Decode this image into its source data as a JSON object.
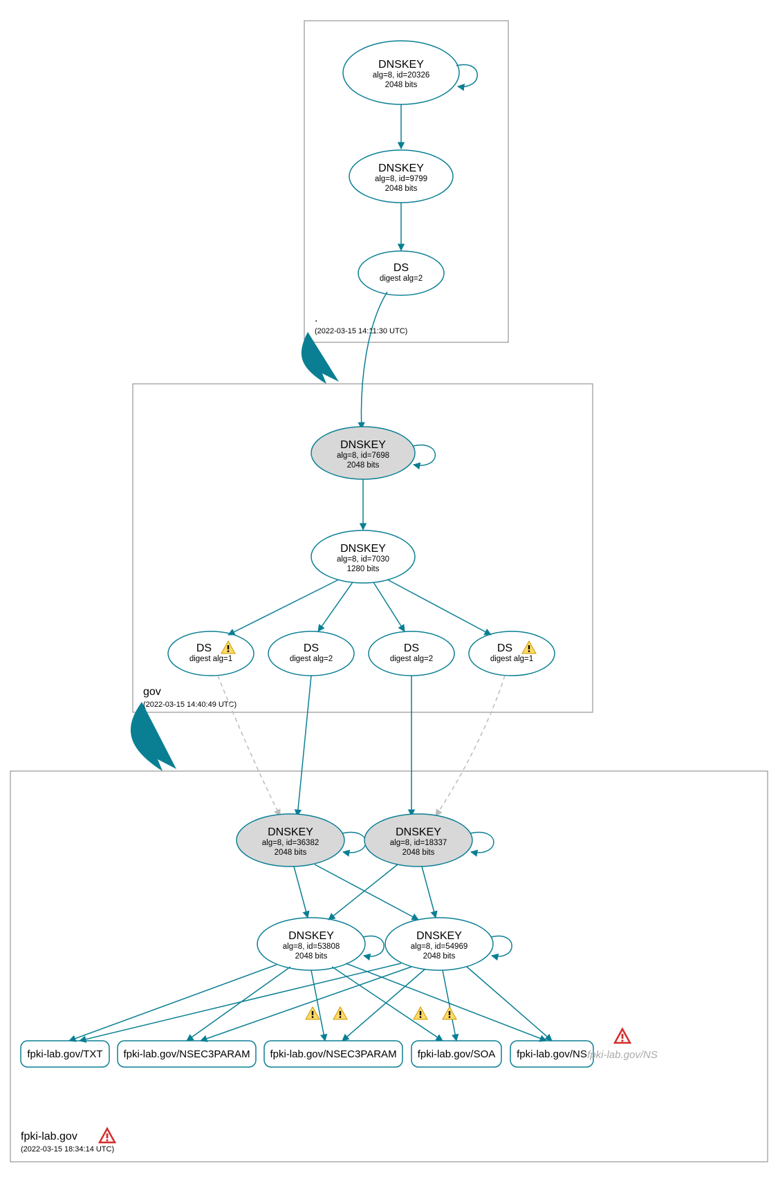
{
  "colors": {
    "accent": "#0a7f94",
    "node_fill": "#d8d8d8",
    "box_stroke": "#808080",
    "warn_yellow": "#ffd966",
    "warn_red": "#d62b2b"
  },
  "zones": {
    "root": {
      "label": ".",
      "timestamp": "(2022-03-15 14:11:30 UTC)"
    },
    "gov": {
      "label": "gov",
      "timestamp": "(2022-03-15 14:40:49 UTC)"
    },
    "leaf": {
      "label": "fpki-lab.gov",
      "timestamp": "(2022-03-15 18:34:14 UTC)",
      "has_error": true
    }
  },
  "nodes": {
    "root_ksk": {
      "title": "DNSKEY",
      "sub1": "alg=8, id=20326",
      "sub2": "2048 bits"
    },
    "root_zsk": {
      "title": "DNSKEY",
      "sub1": "alg=8, id=9799",
      "sub2": "2048 bits"
    },
    "root_ds": {
      "title": "DS",
      "sub1": "digest alg=2",
      "sub2": ""
    },
    "gov_ksk": {
      "title": "DNSKEY",
      "sub1": "alg=8, id=7698",
      "sub2": "2048 bits"
    },
    "gov_zsk": {
      "title": "DNSKEY",
      "sub1": "alg=8, id=7030",
      "sub2": "1280 bits"
    },
    "gov_ds1": {
      "title": "DS",
      "sub1": "digest alg=1",
      "warn": true
    },
    "gov_ds2": {
      "title": "DS",
      "sub1": "digest alg=2"
    },
    "gov_ds3": {
      "title": "DS",
      "sub1": "digest alg=2"
    },
    "gov_ds4": {
      "title": "DS",
      "sub1": "digest alg=1",
      "warn": true
    },
    "leaf_ksk1": {
      "title": "DNSKEY",
      "sub1": "alg=8, id=36382",
      "sub2": "2048 bits"
    },
    "leaf_ksk2": {
      "title": "DNSKEY",
      "sub1": "alg=8, id=18337",
      "sub2": "2048 bits"
    },
    "leaf_zsk1": {
      "title": "DNSKEY",
      "sub1": "alg=8, id=53808",
      "sub2": "2048 bits"
    },
    "leaf_zsk2": {
      "title": "DNSKEY",
      "sub1": "alg=8, id=54969",
      "sub2": "2048 bits"
    }
  },
  "rrsets": {
    "txt": {
      "label": "fpki-lab.gov/TXT"
    },
    "nsec1": {
      "label": "fpki-lab.gov/NSEC3PARAM"
    },
    "nsec2": {
      "label": "fpki-lab.gov/NSEC3PARAM"
    },
    "soa": {
      "label": "fpki-lab.gov/SOA"
    },
    "ns": {
      "label": "fpki-lab.gov/NS"
    },
    "ns_err": {
      "label": "fpki-lab.gov/NS"
    }
  },
  "chart_data": {
    "type": "graph",
    "description": "DNSSEC authentication chain (DNSViz-style)",
    "zones": [
      {
        "name": ".",
        "timestamp": "2022-03-15 14:11:30 UTC"
      },
      {
        "name": "gov",
        "timestamp": "2022-03-15 14:40:49 UTC"
      },
      {
        "name": "fpki-lab.gov",
        "timestamp": "2022-03-15 18:34:14 UTC",
        "status": "error"
      }
    ],
    "nodes": [
      {
        "id": "root_ksk",
        "zone": ".",
        "type": "DNSKEY",
        "alg": 8,
        "key_id": 20326,
        "bits": 2048,
        "role": "KSK",
        "trust_anchor": true,
        "self_sig": true
      },
      {
        "id": "root_zsk",
        "zone": ".",
        "type": "DNSKEY",
        "alg": 8,
        "key_id": 9799,
        "bits": 2048,
        "role": "ZSK"
      },
      {
        "id": "root_ds",
        "zone": ".",
        "type": "DS",
        "digest_alg": 2
      },
      {
        "id": "gov_ksk",
        "zone": "gov",
        "type": "DNSKEY",
        "alg": 8,
        "key_id": 7698,
        "bits": 2048,
        "role": "KSK",
        "self_sig": true
      },
      {
        "id": "gov_zsk",
        "zone": "gov",
        "type": "DNSKEY",
        "alg": 8,
        "key_id": 7030,
        "bits": 1280,
        "role": "ZSK"
      },
      {
        "id": "gov_ds1",
        "zone": "gov",
        "type": "DS",
        "digest_alg": 1,
        "status": "warning"
      },
      {
        "id": "gov_ds2",
        "zone": "gov",
        "type": "DS",
        "digest_alg": 2
      },
      {
        "id": "gov_ds3",
        "zone": "gov",
        "type": "DS",
        "digest_alg": 2
      },
      {
        "id": "gov_ds4",
        "zone": "gov",
        "type": "DS",
        "digest_alg": 1,
        "status": "warning"
      },
      {
        "id": "leaf_ksk1",
        "zone": "fpki-lab.gov",
        "type": "DNSKEY",
        "alg": 8,
        "key_id": 36382,
        "bits": 2048,
        "role": "KSK",
        "self_sig": true
      },
      {
        "id": "leaf_ksk2",
        "zone": "fpki-lab.gov",
        "type": "DNSKEY",
        "alg": 8,
        "key_id": 18337,
        "bits": 2048,
        "role": "KSK",
        "self_sig": true
      },
      {
        "id": "leaf_zsk1",
        "zone": "fpki-lab.gov",
        "type": "DNSKEY",
        "alg": 8,
        "key_id": 53808,
        "bits": 2048,
        "role": "ZSK",
        "self_sig": true
      },
      {
        "id": "leaf_zsk2",
        "zone": "fpki-lab.gov",
        "type": "DNSKEY",
        "alg": 8,
        "key_id": 54969,
        "bits": 2048,
        "role": "ZSK",
        "self_sig": true
      },
      {
        "id": "rr_txt",
        "zone": "fpki-lab.gov",
        "type": "RRset",
        "name": "fpki-lab.gov/TXT"
      },
      {
        "id": "rr_nsec1",
        "zone": "fpki-lab.gov",
        "type": "RRset",
        "name": "fpki-lab.gov/NSEC3PARAM"
      },
      {
        "id": "rr_nsec2",
        "zone": "fpki-lab.gov",
        "type": "RRset",
        "name": "fpki-lab.gov/NSEC3PARAM"
      },
      {
        "id": "rr_soa",
        "zone": "fpki-lab.gov",
        "type": "RRset",
        "name": "fpki-lab.gov/SOA"
      },
      {
        "id": "rr_ns",
        "zone": "fpki-lab.gov",
        "type": "RRset",
        "name": "fpki-lab.gov/NS"
      },
      {
        "id": "rr_ns_err",
        "zone": "fpki-lab.gov",
        "type": "RRset",
        "name": "fpki-lab.gov/NS",
        "status": "error"
      }
    ],
    "edges": [
      {
        "from": "root_ksk",
        "to": "root_ksk",
        "kind": "self-loop"
      },
      {
        "from": "root_ksk",
        "to": "root_zsk"
      },
      {
        "from": "root_zsk",
        "to": "root_ds"
      },
      {
        "from": "root_ds",
        "to": "gov_ksk"
      },
      {
        "from": "gov_ksk",
        "to": "gov_ksk",
        "kind": "self-loop"
      },
      {
        "from": "gov_ksk",
        "to": "gov_zsk"
      },
      {
        "from": "gov_zsk",
        "to": "gov_ds1"
      },
      {
        "from": "gov_zsk",
        "to": "gov_ds2"
      },
      {
        "from": "gov_zsk",
        "to": "gov_ds3"
      },
      {
        "from": "gov_zsk",
        "to": "gov_ds4"
      },
      {
        "from": "gov_ds1",
        "to": "leaf_ksk1",
        "style": "dashed"
      },
      {
        "from": "gov_ds2",
        "to": "leaf_ksk1"
      },
      {
        "from": "gov_ds3",
        "to": "leaf_ksk2"
      },
      {
        "from": "gov_ds4",
        "to": "leaf_ksk2",
        "style": "dashed"
      },
      {
        "from": "leaf_ksk1",
        "to": "leaf_ksk1",
        "kind": "self-loop"
      },
      {
        "from": "leaf_ksk2",
        "to": "leaf_ksk2",
        "kind": "self-loop"
      },
      {
        "from": "leaf_ksk1",
        "to": "leaf_zsk1"
      },
      {
        "from": "leaf_ksk1",
        "to": "leaf_zsk2"
      },
      {
        "from": "leaf_ksk2",
        "to": "leaf_zsk1"
      },
      {
        "from": "leaf_ksk2",
        "to": "leaf_zsk2"
      },
      {
        "from": "leaf_zsk1",
        "to": "leaf_zsk1",
        "kind": "self-loop"
      },
      {
        "from": "leaf_zsk2",
        "to": "leaf_zsk2",
        "kind": "self-loop"
      },
      {
        "from": "leaf_zsk1",
        "to": "rr_txt"
      },
      {
        "from": "leaf_zsk1",
        "to": "rr_nsec1"
      },
      {
        "from": "leaf_zsk1",
        "to": "rr_nsec2",
        "status": "warning"
      },
      {
        "from": "leaf_zsk1",
        "to": "rr_soa",
        "status": "warning"
      },
      {
        "from": "leaf_zsk1",
        "to": "rr_ns"
      },
      {
        "from": "leaf_zsk2",
        "to": "rr_txt"
      },
      {
        "from": "leaf_zsk2",
        "to": "rr_nsec1",
        "status": "warning"
      },
      {
        "from": "leaf_zsk2",
        "to": "rr_nsec2"
      },
      {
        "from": "leaf_zsk2",
        "to": "rr_soa"
      },
      {
        "from": "leaf_zsk2",
        "to": "rr_ns",
        "status": "warning"
      }
    ],
    "delegation_arrows": [
      {
        "from_zone": ".",
        "to_zone": "gov"
      },
      {
        "from_zone": "gov",
        "to_zone": "fpki-lab.gov"
      }
    ]
  }
}
